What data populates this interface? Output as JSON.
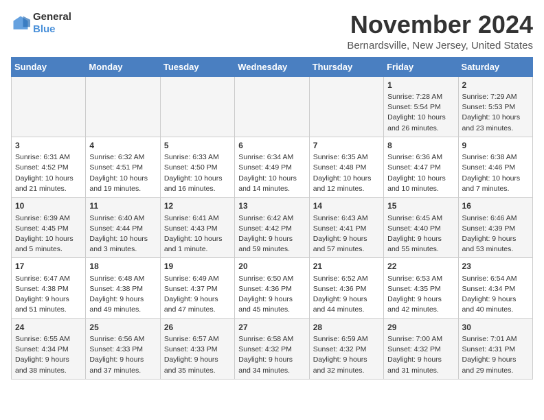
{
  "logo": {
    "line1": "General",
    "line2": "Blue"
  },
  "title": "November 2024",
  "location": "Bernardsville, New Jersey, United States",
  "days_of_week": [
    "Sunday",
    "Monday",
    "Tuesday",
    "Wednesday",
    "Thursday",
    "Friday",
    "Saturday"
  ],
  "weeks": [
    [
      {
        "day": "",
        "info": ""
      },
      {
        "day": "",
        "info": ""
      },
      {
        "day": "",
        "info": ""
      },
      {
        "day": "",
        "info": ""
      },
      {
        "day": "",
        "info": ""
      },
      {
        "day": "1",
        "info": "Sunrise: 7:28 AM\nSunset: 5:54 PM\nDaylight: 10 hours and 26 minutes."
      },
      {
        "day": "2",
        "info": "Sunrise: 7:29 AM\nSunset: 5:53 PM\nDaylight: 10 hours and 23 minutes."
      }
    ],
    [
      {
        "day": "3",
        "info": "Sunrise: 6:31 AM\nSunset: 4:52 PM\nDaylight: 10 hours and 21 minutes."
      },
      {
        "day": "4",
        "info": "Sunrise: 6:32 AM\nSunset: 4:51 PM\nDaylight: 10 hours and 19 minutes."
      },
      {
        "day": "5",
        "info": "Sunrise: 6:33 AM\nSunset: 4:50 PM\nDaylight: 10 hours and 16 minutes."
      },
      {
        "day": "6",
        "info": "Sunrise: 6:34 AM\nSunset: 4:49 PM\nDaylight: 10 hours and 14 minutes."
      },
      {
        "day": "7",
        "info": "Sunrise: 6:35 AM\nSunset: 4:48 PM\nDaylight: 10 hours and 12 minutes."
      },
      {
        "day": "8",
        "info": "Sunrise: 6:36 AM\nSunset: 4:47 PM\nDaylight: 10 hours and 10 minutes."
      },
      {
        "day": "9",
        "info": "Sunrise: 6:38 AM\nSunset: 4:46 PM\nDaylight: 10 hours and 7 minutes."
      }
    ],
    [
      {
        "day": "10",
        "info": "Sunrise: 6:39 AM\nSunset: 4:45 PM\nDaylight: 10 hours and 5 minutes."
      },
      {
        "day": "11",
        "info": "Sunrise: 6:40 AM\nSunset: 4:44 PM\nDaylight: 10 hours and 3 minutes."
      },
      {
        "day": "12",
        "info": "Sunrise: 6:41 AM\nSunset: 4:43 PM\nDaylight: 10 hours and 1 minute."
      },
      {
        "day": "13",
        "info": "Sunrise: 6:42 AM\nSunset: 4:42 PM\nDaylight: 9 hours and 59 minutes."
      },
      {
        "day": "14",
        "info": "Sunrise: 6:43 AM\nSunset: 4:41 PM\nDaylight: 9 hours and 57 minutes."
      },
      {
        "day": "15",
        "info": "Sunrise: 6:45 AM\nSunset: 4:40 PM\nDaylight: 9 hours and 55 minutes."
      },
      {
        "day": "16",
        "info": "Sunrise: 6:46 AM\nSunset: 4:39 PM\nDaylight: 9 hours and 53 minutes."
      }
    ],
    [
      {
        "day": "17",
        "info": "Sunrise: 6:47 AM\nSunset: 4:38 PM\nDaylight: 9 hours and 51 minutes."
      },
      {
        "day": "18",
        "info": "Sunrise: 6:48 AM\nSunset: 4:38 PM\nDaylight: 9 hours and 49 minutes."
      },
      {
        "day": "19",
        "info": "Sunrise: 6:49 AM\nSunset: 4:37 PM\nDaylight: 9 hours and 47 minutes."
      },
      {
        "day": "20",
        "info": "Sunrise: 6:50 AM\nSunset: 4:36 PM\nDaylight: 9 hours and 45 minutes."
      },
      {
        "day": "21",
        "info": "Sunrise: 6:52 AM\nSunset: 4:36 PM\nDaylight: 9 hours and 44 minutes."
      },
      {
        "day": "22",
        "info": "Sunrise: 6:53 AM\nSunset: 4:35 PM\nDaylight: 9 hours and 42 minutes."
      },
      {
        "day": "23",
        "info": "Sunrise: 6:54 AM\nSunset: 4:34 PM\nDaylight: 9 hours and 40 minutes."
      }
    ],
    [
      {
        "day": "24",
        "info": "Sunrise: 6:55 AM\nSunset: 4:34 PM\nDaylight: 9 hours and 38 minutes."
      },
      {
        "day": "25",
        "info": "Sunrise: 6:56 AM\nSunset: 4:33 PM\nDaylight: 9 hours and 37 minutes."
      },
      {
        "day": "26",
        "info": "Sunrise: 6:57 AM\nSunset: 4:33 PM\nDaylight: 9 hours and 35 minutes."
      },
      {
        "day": "27",
        "info": "Sunrise: 6:58 AM\nSunset: 4:32 PM\nDaylight: 9 hours and 34 minutes."
      },
      {
        "day": "28",
        "info": "Sunrise: 6:59 AM\nSunset: 4:32 PM\nDaylight: 9 hours and 32 minutes."
      },
      {
        "day": "29",
        "info": "Sunrise: 7:00 AM\nSunset: 4:32 PM\nDaylight: 9 hours and 31 minutes."
      },
      {
        "day": "30",
        "info": "Sunrise: 7:01 AM\nSunset: 4:31 PM\nDaylight: 9 hours and 29 minutes."
      }
    ]
  ]
}
